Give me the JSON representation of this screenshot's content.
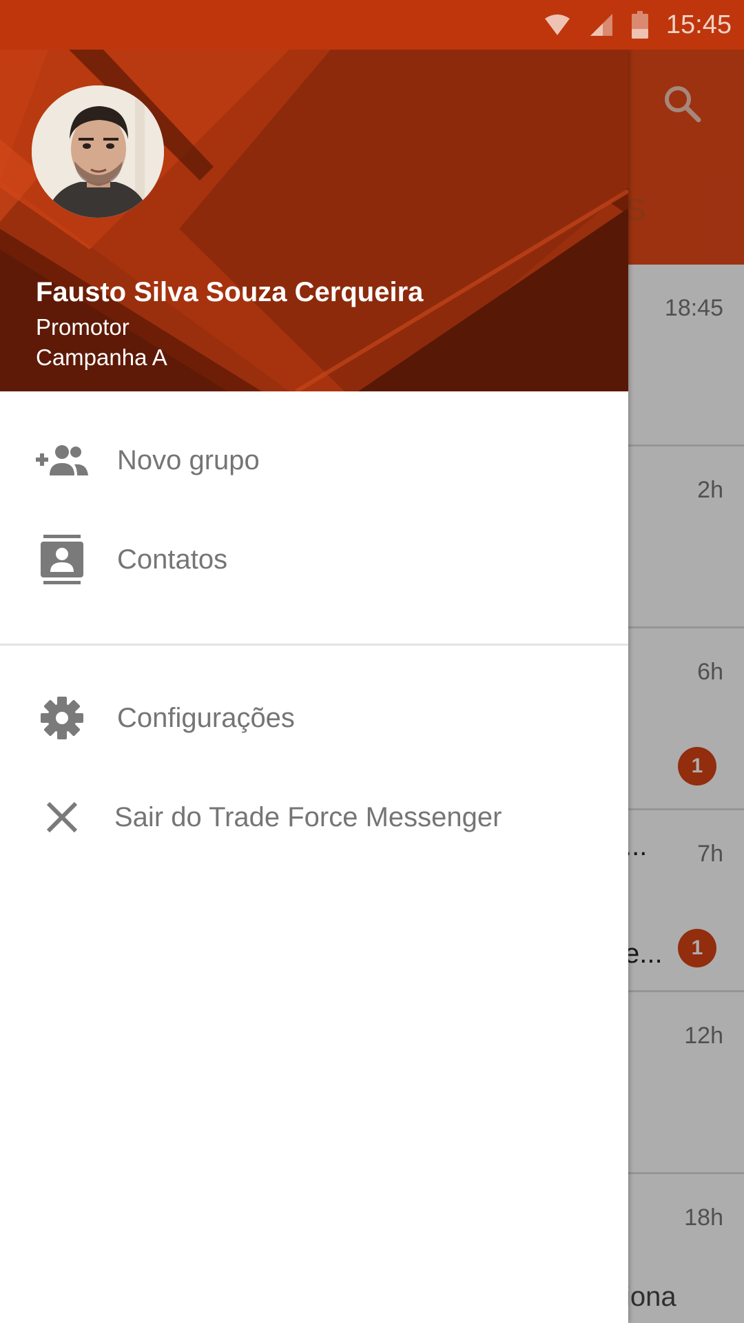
{
  "status_bar": {
    "time": "15:45",
    "icons": [
      "wifi-icon",
      "signal-icon",
      "battery-icon"
    ],
    "color": "#bf360c"
  },
  "background_app": {
    "toolbar_color": "#e64a19",
    "search_icon": "search-icon",
    "tab_fragment": "S",
    "conversations": [
      {
        "time": "18:45",
        "snippet": "",
        "badge": ""
      },
      {
        "time": "2h",
        "snippet": "",
        "badge": ""
      },
      {
        "time": "6h",
        "snippet": "",
        "badge": "1"
      },
      {
        "time": "7h",
        "snippet": "...",
        "badge": ""
      },
      {
        "time": "",
        "snippet": "e...",
        "badge": "1"
      },
      {
        "time": "12h",
        "snippet": "",
        "badge": ""
      },
      {
        "time": "18h",
        "snippet": "iona",
        "badge": ""
      }
    ]
  },
  "drawer": {
    "header": {
      "name": "Fausto Silva Souza Cerqueira",
      "role": "Promotor",
      "campaign": "Campanha A"
    },
    "menu": [
      {
        "label": "Novo grupo",
        "icon": "add-group-icon"
      },
      {
        "label": "Contatos",
        "icon": "contacts-icon"
      },
      {
        "label": "Configurações",
        "icon": "gear-icon"
      },
      {
        "label": "Sair do Trade Force Messenger",
        "icon": "close-icon"
      }
    ]
  }
}
